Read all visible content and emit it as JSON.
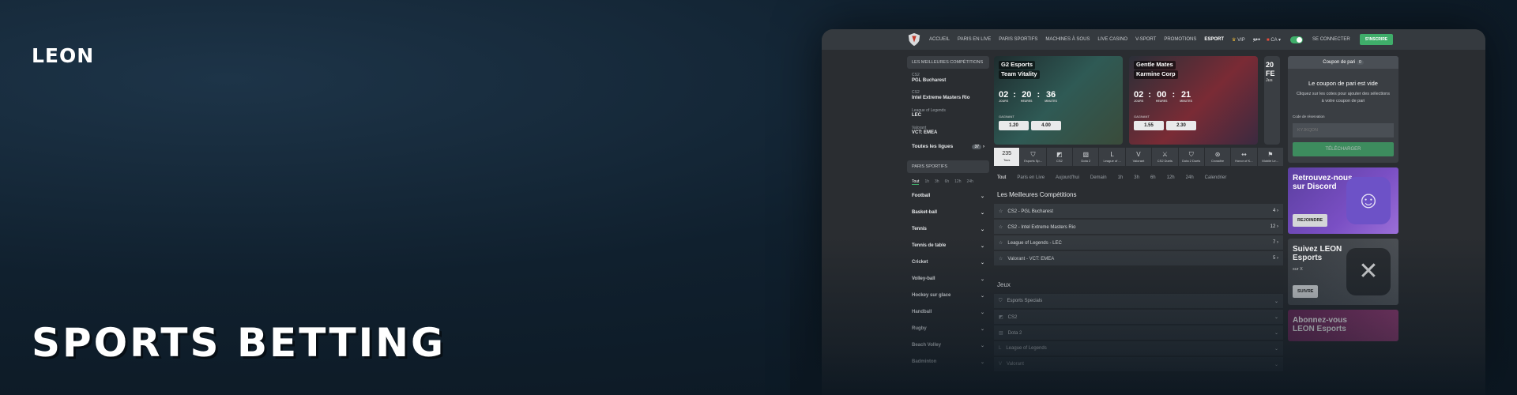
{
  "hero": {
    "logo": "LEON",
    "headline": "SPORTS BETTING"
  },
  "colors": {
    "accent": "#3fae6a",
    "background": "#0f1e2b",
    "panel": "#2a2d31"
  },
  "topbar": {
    "nav": [
      "ACCUEIL",
      "PARIS EN LIVE",
      "PARIS SPORTIFS",
      "MACHINES À SOUS",
      "LIVE CASINO",
      "V-SPORT",
      "PROMOTIONS",
      "ESPORT",
      "VIP"
    ],
    "active": "ESPORT",
    "more_icon": "more-dots-icon",
    "search_icon": "search-icon",
    "lang": "CA",
    "login": "SE CONNECTER",
    "register": "S'INSCRIRE"
  },
  "sidebar": {
    "top_title": "LES MEILLEURES COMPÉTITIONS",
    "competitions": [
      {
        "game": "CS2",
        "name": "PGL Bucharest"
      },
      {
        "game": "CS2",
        "name": "Intel Extreme Masters Rio"
      },
      {
        "game": "League of Legends",
        "name": "LEC"
      },
      {
        "game": "Valorant",
        "name": "VCT: EMEA"
      }
    ],
    "all_leagues": "Toutes les ligues",
    "all_leagues_count": "37",
    "sports_title": "PARIS SPORTIFS",
    "time_filters": [
      "Tout",
      "1h",
      "3h",
      "6h",
      "12h",
      "24h"
    ],
    "sports": [
      "Football",
      "Basket-ball",
      "Tennis",
      "Tennis de table",
      "Cricket",
      "Volley-ball",
      "Hockey sur glace",
      "Handball",
      "Rugby",
      "Beach Volley",
      "Badminton"
    ]
  },
  "banners": [
    {
      "team1": "G2 Esports",
      "team2": "Team Vitality",
      "d": "02",
      "h": "20",
      "m": "36",
      "label_d": "JOURS",
      "label_h": "HEURES",
      "label_m": "MINUTES",
      "winner": "GAGNANT",
      "odd1": "1.20",
      "odd2": "4.00"
    },
    {
      "team1": "Gentle Mates",
      "team2": "Karmine Corp",
      "d": "02",
      "h": "00",
      "m": "21",
      "label_d": "JOURS",
      "label_h": "HEURES",
      "label_m": "MINUTES",
      "winner": "GAGNANT",
      "odd1": "1.55",
      "odd2": "2.30"
    }
  ],
  "third_banner": {
    "top": "20",
    "mid": "FE",
    "bottom": "Jus"
  },
  "games_bar": [
    {
      "label": "Tous",
      "count": "235",
      "icon": "all-icon"
    },
    {
      "label": "Esports Sp...",
      "icon": "shield-icon"
    },
    {
      "label": "CS2",
      "icon": "cs2-icon"
    },
    {
      "label": "Dota 2",
      "icon": "dota2-icon"
    },
    {
      "label": "League of ...",
      "icon": "lol-icon"
    },
    {
      "label": "Valorant",
      "icon": "valorant-icon"
    },
    {
      "label": "CS2 Duels",
      "icon": "cs2-duels-icon"
    },
    {
      "label": "Dota 2 Duels",
      "icon": "dota2-duels-icon"
    },
    {
      "label": "Crossfire",
      "icon": "crossfire-icon"
    },
    {
      "label": "Honor of K...",
      "icon": "hok-icon"
    },
    {
      "label": "Mobile Le...",
      "icon": "mobile-legends-icon"
    }
  ],
  "tabs": [
    "Tout",
    "Paris en Live",
    "Aujourd'hui",
    "Demain",
    "1h",
    "3h",
    "6h",
    "12h",
    "24h",
    "Calendrier"
  ],
  "top_competitions": {
    "title": "Les Meilleures Compétitions",
    "rows": [
      {
        "name": "CS2 - PGL Bucharest",
        "count": "4"
      },
      {
        "name": "CS2 - Intel Extreme Masters Rio",
        "count": "12"
      },
      {
        "name": "League of Legends - LEC",
        "count": "7"
      },
      {
        "name": "Valorant - VCT: EMEA",
        "count": "5"
      }
    ]
  },
  "games": {
    "title": "Jeux",
    "rows": [
      "Esports Specials",
      "CS2",
      "Dota 2",
      "League of Legends",
      "Valorant"
    ]
  },
  "coupon": {
    "title": "Coupon de pari",
    "count": "0",
    "empty": "Le coupon de pari est vide",
    "help": "Cliquez sur les cotes pour ajouter des sélections à votre coupon de pari",
    "code_label": "Code de réservation",
    "code_placeholder": "KYJKQDN",
    "upload": "TÉLÉCHARGER"
  },
  "promos": [
    {
      "title": "Retrouvez-nous sur Discord",
      "sub": "",
      "button": "REJOINDRE"
    },
    {
      "title": "Suivez LEON Esports",
      "sub": "sur X",
      "button": "SUIVRE"
    },
    {
      "title": "Abonnez-vous LEON Esports",
      "sub": "",
      "button": ""
    }
  ]
}
